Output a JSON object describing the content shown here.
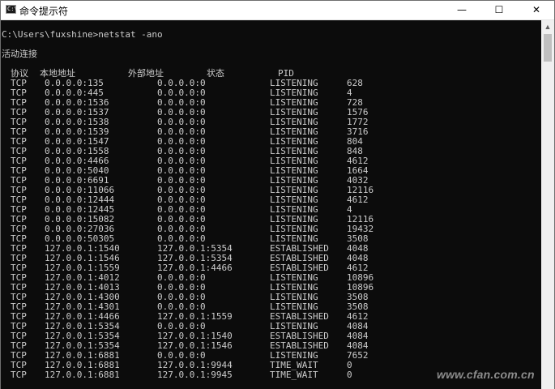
{
  "window": {
    "title": "命令提示符",
    "icon_label": "C:\\",
    "buttons": {
      "minimize": "—",
      "maximize": "☐",
      "close": "✕"
    }
  },
  "console": {
    "command_line": "C:\\Users\\fuxshine>netstat -ano",
    "section_title": "活动连接",
    "headers": [
      "协议",
      "本地地址",
      "外部地址",
      "状态",
      "PID"
    ],
    "rows": [
      [
        "TCP",
        "0.0.0.0:135",
        "0.0.0.0:0",
        "LISTENING",
        "628"
      ],
      [
        "TCP",
        "0.0.0.0:445",
        "0.0.0.0:0",
        "LISTENING",
        "4"
      ],
      [
        "TCP",
        "0.0.0.0:1536",
        "0.0.0.0:0",
        "LISTENING",
        "728"
      ],
      [
        "TCP",
        "0.0.0.0:1537",
        "0.0.0.0:0",
        "LISTENING",
        "1576"
      ],
      [
        "TCP",
        "0.0.0.0:1538",
        "0.0.0.0:0",
        "LISTENING",
        "1772"
      ],
      [
        "TCP",
        "0.0.0.0:1539",
        "0.0.0.0:0",
        "LISTENING",
        "3716"
      ],
      [
        "TCP",
        "0.0.0.0:1547",
        "0.0.0.0:0",
        "LISTENING",
        "804"
      ],
      [
        "TCP",
        "0.0.0.0:1558",
        "0.0.0.0:0",
        "LISTENING",
        "848"
      ],
      [
        "TCP",
        "0.0.0.0:4466",
        "0.0.0.0:0",
        "LISTENING",
        "4612"
      ],
      [
        "TCP",
        "0.0.0.0:5040",
        "0.0.0.0:0",
        "LISTENING",
        "1664"
      ],
      [
        "TCP",
        "0.0.0.0:6691",
        "0.0.0.0:0",
        "LISTENING",
        "4032"
      ],
      [
        "TCP",
        "0.0.0.0:11066",
        "0.0.0.0:0",
        "LISTENING",
        "12116"
      ],
      [
        "TCP",
        "0.0.0.0:12444",
        "0.0.0.0:0",
        "LISTENING",
        "4612"
      ],
      [
        "TCP",
        "0.0.0.0:12445",
        "0.0.0.0:0",
        "LISTENING",
        "4"
      ],
      [
        "TCP",
        "0.0.0.0:15082",
        "0.0.0.0:0",
        "LISTENING",
        "12116"
      ],
      [
        "TCP",
        "0.0.0.0:27036",
        "0.0.0.0:0",
        "LISTENING",
        "19432"
      ],
      [
        "TCP",
        "0.0.0.0:50305",
        "0.0.0.0:0",
        "LISTENING",
        "3508"
      ],
      [
        "TCP",
        "127.0.0.1:1540",
        "127.0.0.1:5354",
        "ESTABLISHED",
        "4048"
      ],
      [
        "TCP",
        "127.0.0.1:1546",
        "127.0.0.1:5354",
        "ESTABLISHED",
        "4048"
      ],
      [
        "TCP",
        "127.0.0.1:1559",
        "127.0.0.1:4466",
        "ESTABLISHED",
        "4612"
      ],
      [
        "TCP",
        "127.0.0.1:4012",
        "0.0.0.0:0",
        "LISTENING",
        "10896"
      ],
      [
        "TCP",
        "127.0.0.1:4013",
        "0.0.0.0:0",
        "LISTENING",
        "10896"
      ],
      [
        "TCP",
        "127.0.0.1:4300",
        "0.0.0.0:0",
        "LISTENING",
        "3508"
      ],
      [
        "TCP",
        "127.0.0.1:4301",
        "0.0.0.0:0",
        "LISTENING",
        "3508"
      ],
      [
        "TCP",
        "127.0.0.1:4466",
        "127.0.0.1:1559",
        "ESTABLISHED",
        "4612"
      ],
      [
        "TCP",
        "127.0.0.1:5354",
        "0.0.0.0:0",
        "LISTENING",
        "4084"
      ],
      [
        "TCP",
        "127.0.0.1:5354",
        "127.0.0.1:1540",
        "ESTABLISHED",
        "4084"
      ],
      [
        "TCP",
        "127.0.0.1:5354",
        "127.0.0.1:1546",
        "ESTABLISHED",
        "4084"
      ],
      [
        "TCP",
        "127.0.0.1:6881",
        "0.0.0.0:0",
        "LISTENING",
        "7652"
      ],
      [
        "TCP",
        "127.0.0.1:6881",
        "127.0.0.1:9944",
        "TIME_WAIT",
        "0"
      ],
      [
        "TCP",
        "127.0.0.1:6881",
        "127.0.0.1:9945",
        "TIME_WAIT",
        "0"
      ]
    ]
  },
  "watermark": "www.cfan.com.cn",
  "colors": {
    "console_bg": "#0c0c0c",
    "console_fg": "#cccccc",
    "titlebar_bg": "#ffffff"
  }
}
